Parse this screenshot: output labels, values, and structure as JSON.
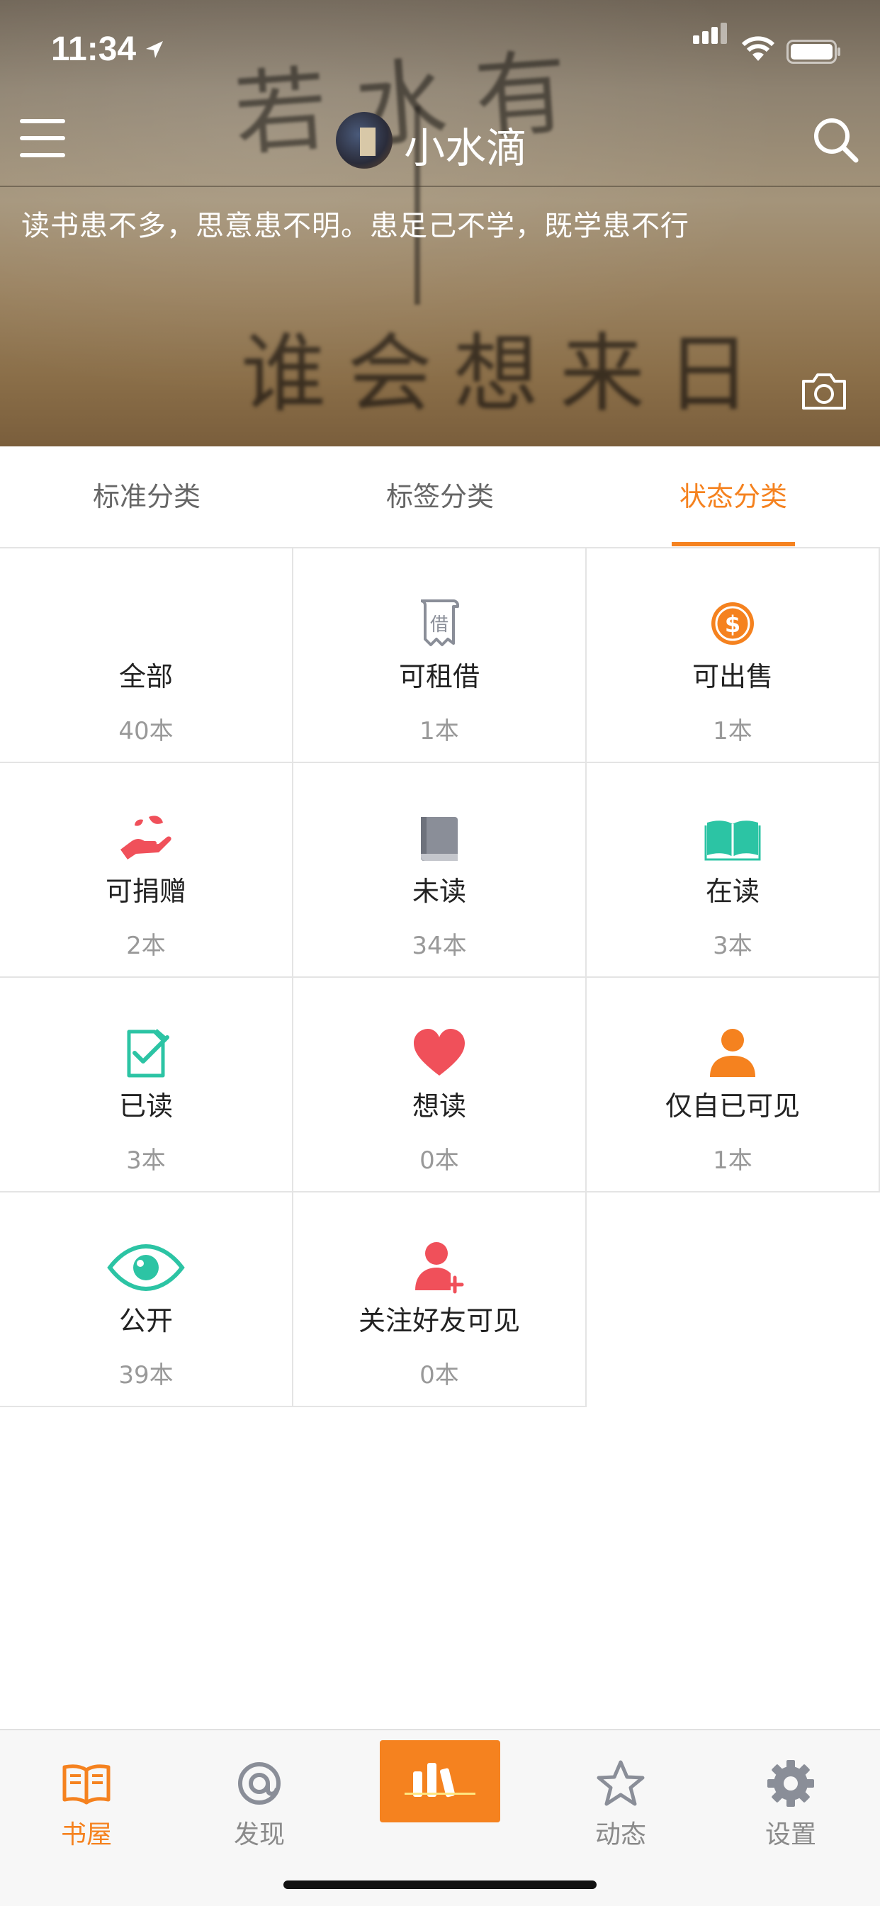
{
  "status_bar": {
    "time": "11:34"
  },
  "header": {
    "username": "小水滴",
    "motto": "读书患不多，思意患不明。患足己不学，既学患不行"
  },
  "tabs": [
    {
      "label": "标准分类",
      "active": false
    },
    {
      "label": "标签分类",
      "active": false
    },
    {
      "label": "状态分类",
      "active": true
    }
  ],
  "categories": [
    {
      "label": "全部",
      "count": "40本",
      "icon": "none"
    },
    {
      "label": "可租借",
      "count": "1本",
      "icon": "lend-receipt-icon"
    },
    {
      "label": "可出售",
      "count": "1本",
      "icon": "dollar-coin-icon"
    },
    {
      "label": "可捐赠",
      "count": "2本",
      "icon": "donate-hand-icon"
    },
    {
      "label": "未读",
      "count": "34本",
      "icon": "closed-book-icon"
    },
    {
      "label": "在读",
      "count": "3本",
      "icon": "open-book-icon"
    },
    {
      "label": "已读",
      "count": "3本",
      "icon": "checklist-icon"
    },
    {
      "label": "想读",
      "count": "0本",
      "icon": "heart-icon"
    },
    {
      "label": "仅自已可见",
      "count": "1本",
      "icon": "person-icon"
    },
    {
      "label": "公开",
      "count": "39本",
      "icon": "eye-icon"
    },
    {
      "label": "关注好友可见",
      "count": "0本",
      "icon": "add-friend-icon"
    }
  ],
  "bottom_nav": [
    {
      "label": "书屋",
      "icon": "book-icon",
      "active": true
    },
    {
      "label": "发现",
      "icon": "discover-icon",
      "active": false
    },
    {
      "label": "",
      "icon": "scan-barcode-icon",
      "active": false
    },
    {
      "label": "动态",
      "icon": "star-icon",
      "active": false
    },
    {
      "label": "设置",
      "icon": "gear-icon",
      "active": false
    }
  ],
  "colors": {
    "accent": "#f5821f",
    "teal": "#2cc4a4",
    "red": "#f0505a",
    "gray_icon": "#8a8e98"
  }
}
